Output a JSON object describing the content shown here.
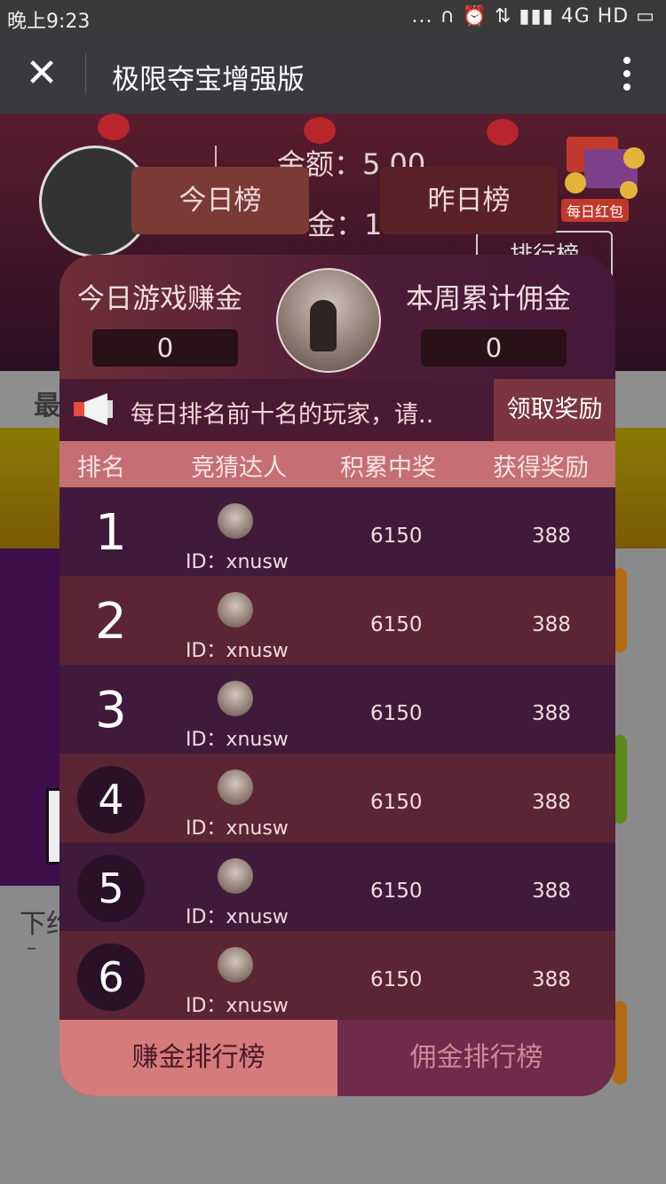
{
  "status": {
    "time": "晚上9:23",
    "right": "... ∩ ⏰ ⇅ ▮▮▮ 4G HD ▭"
  },
  "nav": {
    "close_glyph": "✕",
    "title": "极限夺宝增强版"
  },
  "background": {
    "money_line1": "金额：5.00",
    "money_line2": "金：1",
    "rank_button": "排行榜",
    "redpack_label": "每日红包",
    "section_title": "最",
    "bottom_text": "下约",
    "bottom_dash": "–"
  },
  "tabs": {
    "today": "今日榜",
    "yesterday": "昨日榜"
  },
  "modal": {
    "left_label": "今日游戏赚金",
    "left_value": "0",
    "right_label": "本周累计佣金",
    "right_value": "0",
    "notice_text": "每日排名前十名的玩家，请..",
    "claim_button": "领取奖励",
    "headers": {
      "rank": "排名",
      "player": "竞猜达人",
      "score": "积累中奖",
      "reward": "获得奖励"
    },
    "rows": [
      {
        "rank": "1",
        "id": "ID：xnusw",
        "score": "6150",
        "reward": "388"
      },
      {
        "rank": "2",
        "id": "ID：xnusw",
        "score": "6150",
        "reward": "388"
      },
      {
        "rank": "3",
        "id": "ID：xnusw",
        "score": "6150",
        "reward": "388"
      },
      {
        "rank": "4",
        "id": "ID：xnusw",
        "score": "6150",
        "reward": "388"
      },
      {
        "rank": "5",
        "id": "ID：xnusw",
        "score": "6150",
        "reward": "388"
      },
      {
        "rank": "6",
        "id": "ID：xnusw",
        "score": "6150",
        "reward": "388"
      }
    ],
    "footer": {
      "earn_tab": "赚金排行榜",
      "commission_tab": "佣金排行榜"
    }
  },
  "colors": {
    "accent": "#d67b7c",
    "modal_bg": "#3e1b33"
  }
}
